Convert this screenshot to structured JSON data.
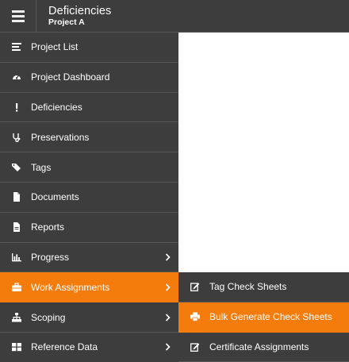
{
  "header": {
    "title": "Deficiencies",
    "subtitle": "Project A",
    "menu_icon": "hamburger-icon"
  },
  "sidebar": {
    "items": [
      {
        "label": "Project List",
        "icon": "list-icon",
        "has_submenu": false
      },
      {
        "label": "Project Dashboard",
        "icon": "dashboard-icon",
        "has_submenu": false
      },
      {
        "label": "Deficiencies",
        "icon": "exclamation-icon",
        "has_submenu": false
      },
      {
        "label": "Preservations",
        "icon": "stethoscope-icon",
        "has_submenu": false
      },
      {
        "label": "Tags",
        "icon": "tags-icon",
        "has_submenu": false
      },
      {
        "label": "Documents",
        "icon": "document-icon",
        "has_submenu": false
      },
      {
        "label": "Reports",
        "icon": "report-icon",
        "has_submenu": false
      },
      {
        "label": "Progress",
        "icon": "bar-chart-icon",
        "has_submenu": true
      },
      {
        "label": "Work Assignments",
        "icon": "briefcase-icon",
        "has_submenu": true,
        "active": true
      },
      {
        "label": "Scoping",
        "icon": "sitemap-icon",
        "has_submenu": true
      },
      {
        "label": "Reference Data",
        "icon": "grid-icon",
        "has_submenu": true
      }
    ]
  },
  "submenu": {
    "items": [
      {
        "label": "Tag Check Sheets",
        "icon": "edit-icon"
      },
      {
        "label": "Bulk Generate Check Sheets",
        "icon": "print-icon",
        "active": true
      },
      {
        "label": "Certificate Assignments",
        "icon": "edit-icon"
      }
    ]
  },
  "colors": {
    "sidebar_bg": "#3d3d3d",
    "divider": "#555555",
    "accent": "#f47c0d",
    "text": "#ffffff",
    "content_bg": "#ffffff"
  }
}
